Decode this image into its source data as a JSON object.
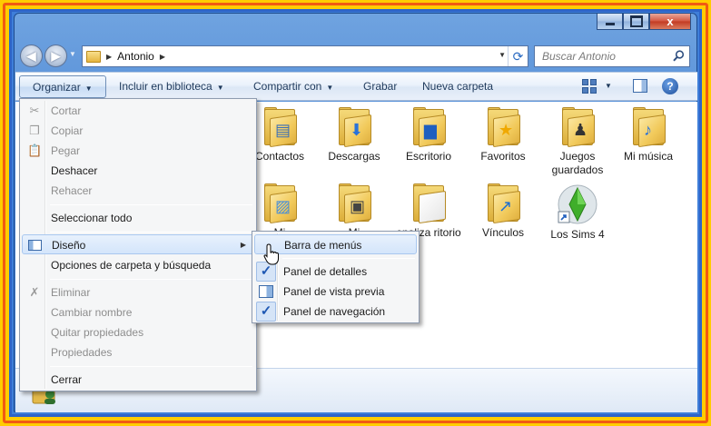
{
  "window": {
    "caption_buttons": {
      "close_symbol": "x"
    }
  },
  "address": {
    "crumb": "Antonio",
    "search_placeholder": "Buscar Antonio"
  },
  "toolbar": {
    "organize": "Organizar",
    "include_library": "Incluir en biblioteca",
    "share_with": "Compartir con",
    "burn": "Grabar",
    "new_folder": "Nueva carpeta"
  },
  "folders": [
    {
      "label": "Contactos",
      "icon": "contacts-card-icon"
    },
    {
      "label": "Descargas",
      "icon": "download-arrow-icon"
    },
    {
      "label": "Escritorio",
      "icon": "desktop-icon"
    },
    {
      "label": "Favoritos",
      "icon": "star-icon"
    },
    {
      "label": "Juegos guardados",
      "icon": "chess-pieces-icon"
    },
    {
      "label": "Mi música",
      "icon": "music-note-icon"
    },
    {
      "label": "Mi",
      "icon": "pictures-icon"
    },
    {
      "label": "Mi",
      "icon": "video-icon"
    },
    {
      "label": "onaliza ritorio",
      "icon": "document-icon"
    },
    {
      "label": "Vínculos",
      "icon": "link-arrow-icon"
    },
    {
      "label": "Los Sims 4",
      "icon": "sims-plumbob-icon"
    }
  ],
  "organize_menu": {
    "cut": "Cortar",
    "copy": "Copiar",
    "paste": "Pegar",
    "undo": "Deshacer",
    "redo": "Rehacer",
    "select_all": "Seleccionar todo",
    "layout": "Diseño",
    "folder_options": "Opciones de carpeta y búsqueda",
    "delete": "Eliminar",
    "rename": "Cambiar nombre",
    "remove_properties": "Quitar propiedades",
    "properties": "Propiedades",
    "close": "Cerrar"
  },
  "layout_menu": {
    "menu_bar": "Barra de menús",
    "details_pane": "Panel de detalles",
    "preview_pane": "Panel de vista previa",
    "navigation_pane": "Panel de navegación",
    "check_symbol": "✓"
  },
  "colors": {
    "frame_outer": "#f15a12",
    "frame_bg": "#ffcc00",
    "window_blue": "#3f7fd9",
    "menu_highlight": "#d4e5fb"
  }
}
